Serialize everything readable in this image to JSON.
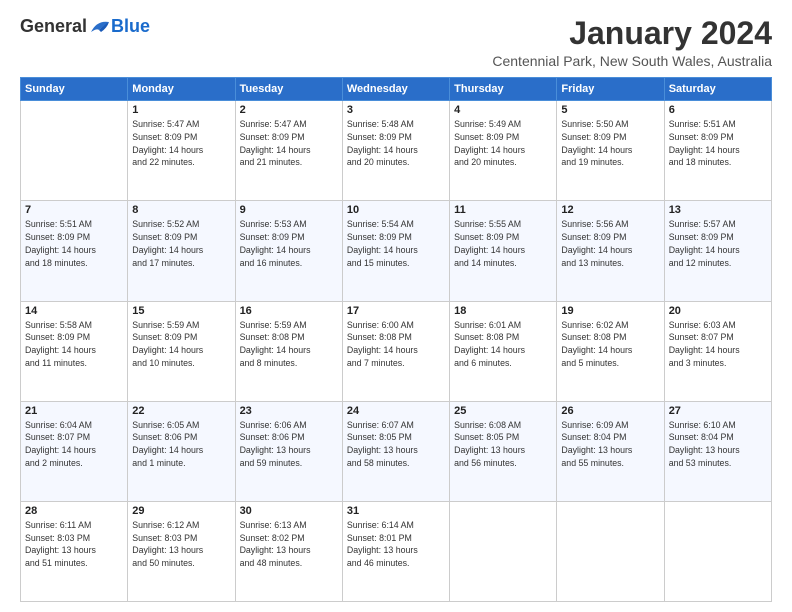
{
  "header": {
    "logo_general": "General",
    "logo_blue": "Blue",
    "month_title": "January 2024",
    "subtitle": "Centennial Park, New South Wales, Australia"
  },
  "weekdays": [
    "Sunday",
    "Monday",
    "Tuesday",
    "Wednesday",
    "Thursday",
    "Friday",
    "Saturday"
  ],
  "weeks": [
    [
      {
        "day": "",
        "info": ""
      },
      {
        "day": "1",
        "info": "Sunrise: 5:47 AM\nSunset: 8:09 PM\nDaylight: 14 hours\nand 22 minutes."
      },
      {
        "day": "2",
        "info": "Sunrise: 5:47 AM\nSunset: 8:09 PM\nDaylight: 14 hours\nand 21 minutes."
      },
      {
        "day": "3",
        "info": "Sunrise: 5:48 AM\nSunset: 8:09 PM\nDaylight: 14 hours\nand 20 minutes."
      },
      {
        "day": "4",
        "info": "Sunrise: 5:49 AM\nSunset: 8:09 PM\nDaylight: 14 hours\nand 20 minutes."
      },
      {
        "day": "5",
        "info": "Sunrise: 5:50 AM\nSunset: 8:09 PM\nDaylight: 14 hours\nand 19 minutes."
      },
      {
        "day": "6",
        "info": "Sunrise: 5:51 AM\nSunset: 8:09 PM\nDaylight: 14 hours\nand 18 minutes."
      }
    ],
    [
      {
        "day": "7",
        "info": "Sunrise: 5:51 AM\nSunset: 8:09 PM\nDaylight: 14 hours\nand 18 minutes."
      },
      {
        "day": "8",
        "info": "Sunrise: 5:52 AM\nSunset: 8:09 PM\nDaylight: 14 hours\nand 17 minutes."
      },
      {
        "day": "9",
        "info": "Sunrise: 5:53 AM\nSunset: 8:09 PM\nDaylight: 14 hours\nand 16 minutes."
      },
      {
        "day": "10",
        "info": "Sunrise: 5:54 AM\nSunset: 8:09 PM\nDaylight: 14 hours\nand 15 minutes."
      },
      {
        "day": "11",
        "info": "Sunrise: 5:55 AM\nSunset: 8:09 PM\nDaylight: 14 hours\nand 14 minutes."
      },
      {
        "day": "12",
        "info": "Sunrise: 5:56 AM\nSunset: 8:09 PM\nDaylight: 14 hours\nand 13 minutes."
      },
      {
        "day": "13",
        "info": "Sunrise: 5:57 AM\nSunset: 8:09 PM\nDaylight: 14 hours\nand 12 minutes."
      }
    ],
    [
      {
        "day": "14",
        "info": "Sunrise: 5:58 AM\nSunset: 8:09 PM\nDaylight: 14 hours\nand 11 minutes."
      },
      {
        "day": "15",
        "info": "Sunrise: 5:59 AM\nSunset: 8:09 PM\nDaylight: 14 hours\nand 10 minutes."
      },
      {
        "day": "16",
        "info": "Sunrise: 5:59 AM\nSunset: 8:08 PM\nDaylight: 14 hours\nand 8 minutes."
      },
      {
        "day": "17",
        "info": "Sunrise: 6:00 AM\nSunset: 8:08 PM\nDaylight: 14 hours\nand 7 minutes."
      },
      {
        "day": "18",
        "info": "Sunrise: 6:01 AM\nSunset: 8:08 PM\nDaylight: 14 hours\nand 6 minutes."
      },
      {
        "day": "19",
        "info": "Sunrise: 6:02 AM\nSunset: 8:08 PM\nDaylight: 14 hours\nand 5 minutes."
      },
      {
        "day": "20",
        "info": "Sunrise: 6:03 AM\nSunset: 8:07 PM\nDaylight: 14 hours\nand 3 minutes."
      }
    ],
    [
      {
        "day": "21",
        "info": "Sunrise: 6:04 AM\nSunset: 8:07 PM\nDaylight: 14 hours\nand 2 minutes."
      },
      {
        "day": "22",
        "info": "Sunrise: 6:05 AM\nSunset: 8:06 PM\nDaylight: 14 hours\nand 1 minute."
      },
      {
        "day": "23",
        "info": "Sunrise: 6:06 AM\nSunset: 8:06 PM\nDaylight: 13 hours\nand 59 minutes."
      },
      {
        "day": "24",
        "info": "Sunrise: 6:07 AM\nSunset: 8:05 PM\nDaylight: 13 hours\nand 58 minutes."
      },
      {
        "day": "25",
        "info": "Sunrise: 6:08 AM\nSunset: 8:05 PM\nDaylight: 13 hours\nand 56 minutes."
      },
      {
        "day": "26",
        "info": "Sunrise: 6:09 AM\nSunset: 8:04 PM\nDaylight: 13 hours\nand 55 minutes."
      },
      {
        "day": "27",
        "info": "Sunrise: 6:10 AM\nSunset: 8:04 PM\nDaylight: 13 hours\nand 53 minutes."
      }
    ],
    [
      {
        "day": "28",
        "info": "Sunrise: 6:11 AM\nSunset: 8:03 PM\nDaylight: 13 hours\nand 51 minutes."
      },
      {
        "day": "29",
        "info": "Sunrise: 6:12 AM\nSunset: 8:03 PM\nDaylight: 13 hours\nand 50 minutes."
      },
      {
        "day": "30",
        "info": "Sunrise: 6:13 AM\nSunset: 8:02 PM\nDaylight: 13 hours\nand 48 minutes."
      },
      {
        "day": "31",
        "info": "Sunrise: 6:14 AM\nSunset: 8:01 PM\nDaylight: 13 hours\nand 46 minutes."
      },
      {
        "day": "",
        "info": ""
      },
      {
        "day": "",
        "info": ""
      },
      {
        "day": "",
        "info": ""
      }
    ]
  ]
}
